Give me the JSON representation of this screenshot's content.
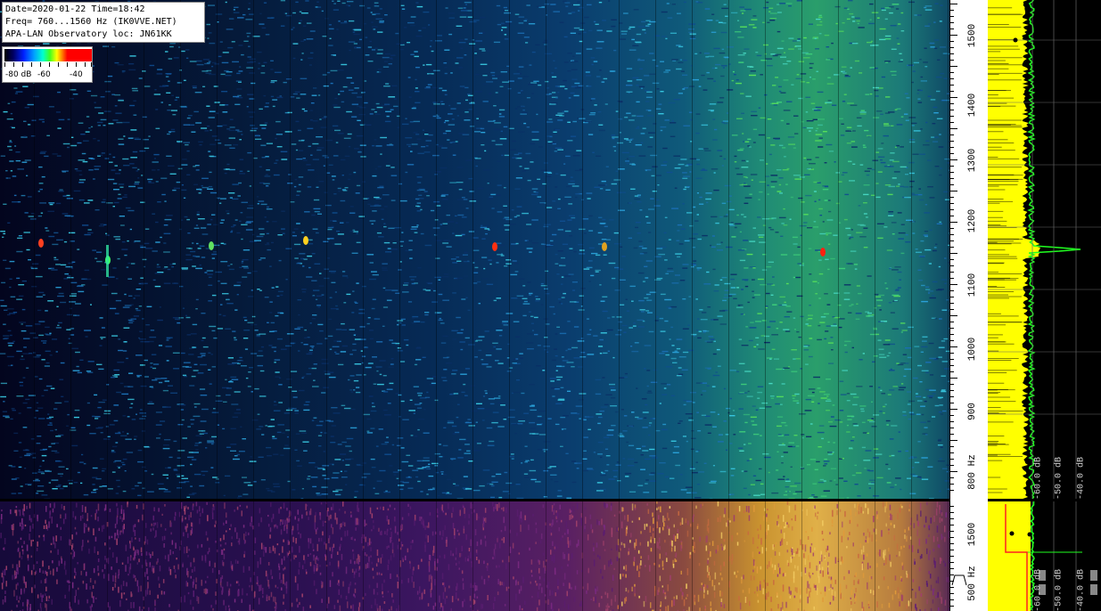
{
  "header": {
    "date_time": "Date=2020-01-22 Time=18:42",
    "freq_range": "Freq= 760...1560 Hz (IK0VVE.NET)",
    "observatory": "APA-LAN Observatory loc: JN61KK"
  },
  "color_legend": {
    "label_min": "-80 dB",
    "label_mid": "-60",
    "label_max": "-40"
  },
  "frequency_axis": {
    "main_ticks": [
      "1500",
      "1400",
      "1300",
      "1200",
      "1100",
      "1000",
      "900",
      "800 Hz"
    ],
    "sub_ticks": [
      "1500",
      "500 Hz"
    ]
  },
  "spectrum_panel": {
    "db_labels_main": [
      "-60.0 dB",
      "-50.0 dB",
      "-40.0 dB"
    ],
    "db_labels_sub": [
      "-60.0 dB",
      "-50.0 dB",
      "-40.0 dB"
    ]
  },
  "colors": {
    "spectrum_yellow": "#ffff00",
    "spectrum_green": "#20ff20",
    "marker_red": "#ff2020",
    "waterfall_blue": "#0a3d6e",
    "waterfall_purple": "#3c1660"
  }
}
